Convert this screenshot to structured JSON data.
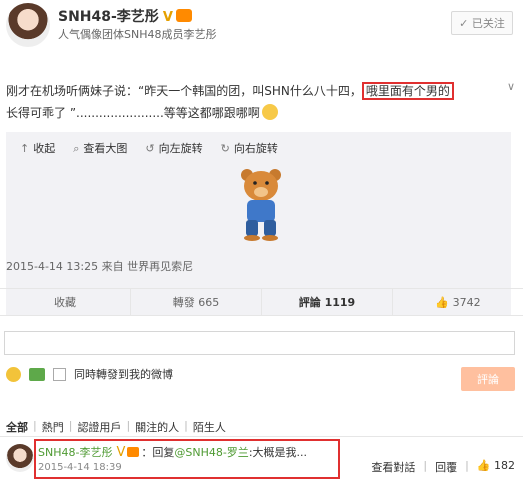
{
  "header": {
    "username": "SNH48-李艺彤",
    "bio": "人气偶像团体SNH48成员李艺彤",
    "follow_label": "已关注"
  },
  "post": {
    "text_before": "刚才在机场听俩妹子说：“昨天一个韩国的团，叫SHN什么八十四，",
    "highlight": "哦里面有个男的",
    "text_after": "长得可乖了 ”.......................等等这都哪跟哪啊",
    "media_tools": [
      "收起",
      "查看大图",
      "向左旋转",
      "向右旋转"
    ],
    "meta": "2015-4-14 13:25 来自 世界再见索尼"
  },
  "actions": {
    "favorite": "收藏",
    "repost": "轉發 665",
    "comment": "評論 1119",
    "like": "3742"
  },
  "composer": {
    "checkbox_label": "同時轉發到我的微博",
    "submit_label": "評論"
  },
  "tabs": [
    "全部",
    "熱門",
    "認證用戶",
    "關注的人",
    "陌生人"
  ],
  "reply": {
    "name": "SNH48-李艺彤",
    "reply_prefix": "：回复",
    "mention": "@SNH48-罗兰",
    "text": ":大概是我...",
    "date": "2015-4-14 18:39",
    "view_conv": "查看對話",
    "reply_label": "回覆",
    "likes": "182"
  },
  "colors": {
    "highlight_border": "#e03030",
    "green_name": "#4e9a32",
    "submit_bg": "#ffc09f"
  }
}
